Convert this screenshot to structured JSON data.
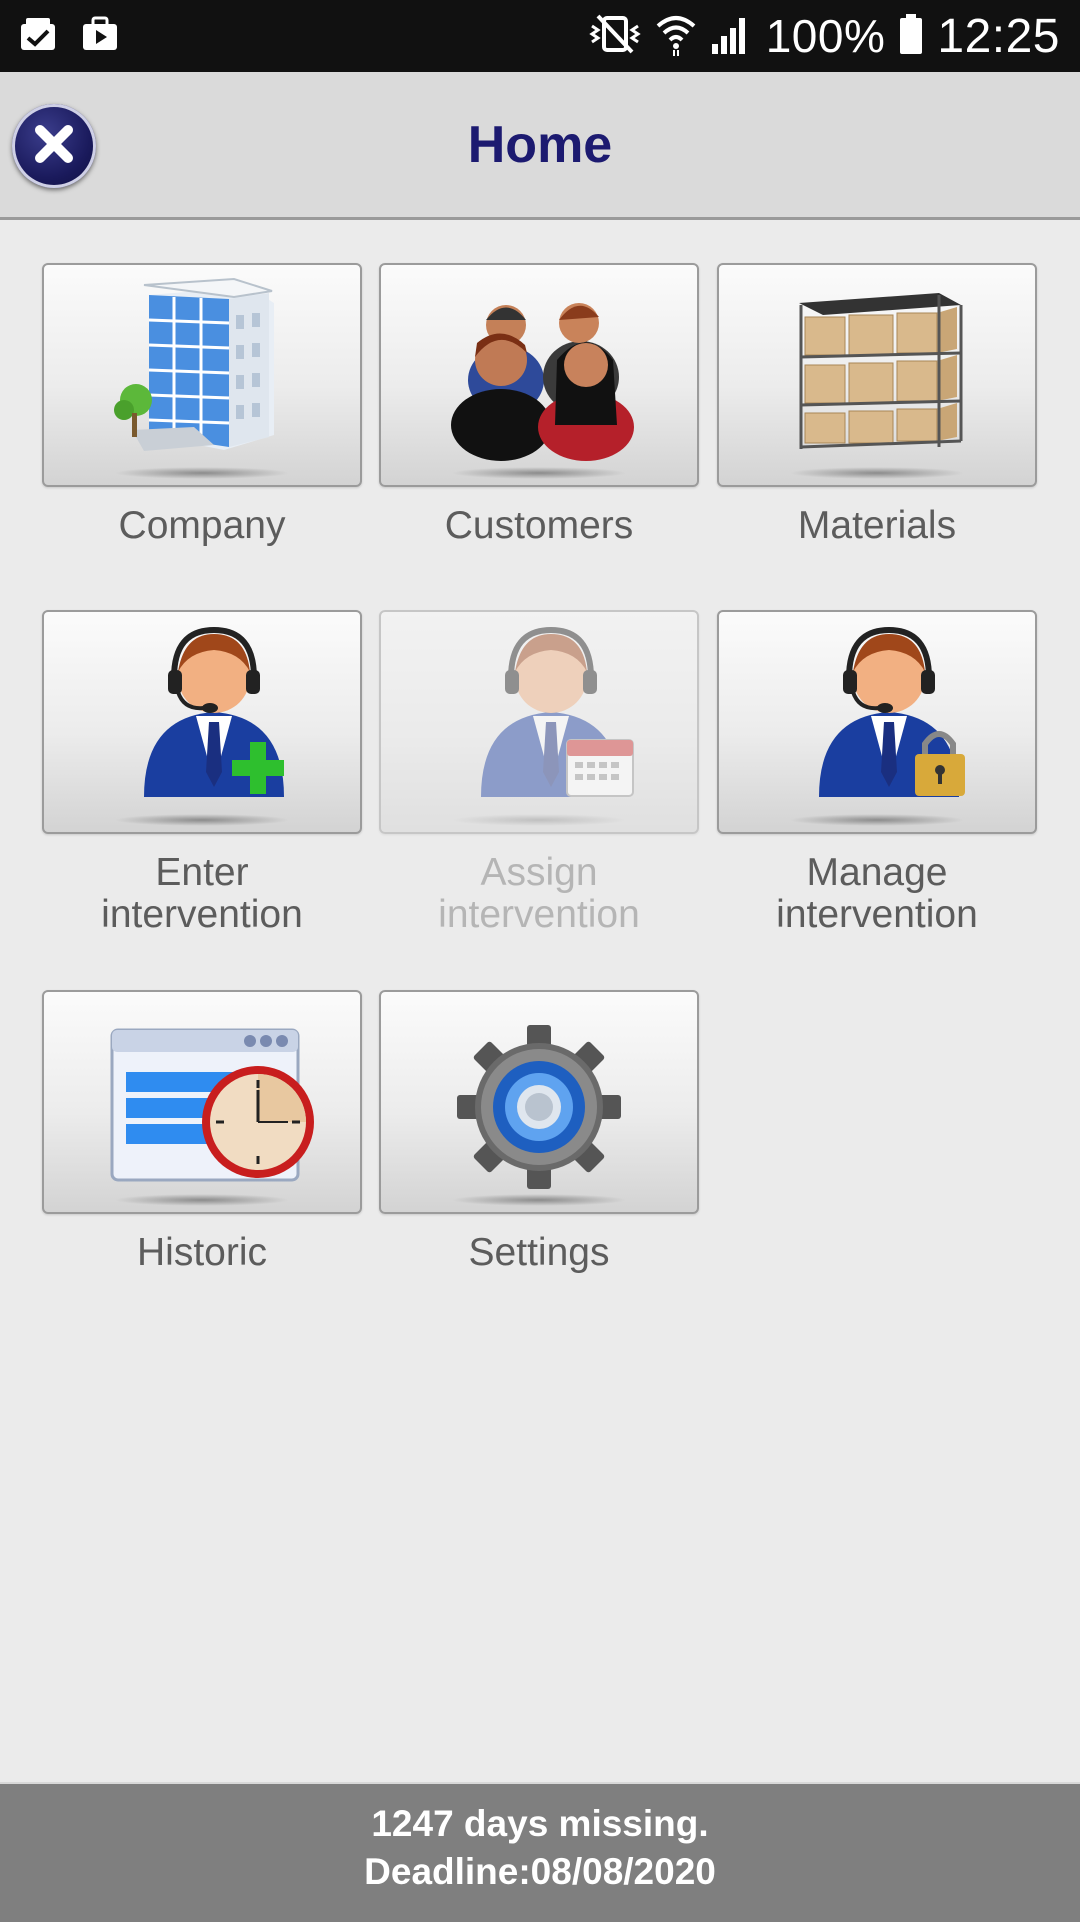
{
  "status_bar": {
    "battery": "100%",
    "time": "12:25",
    "icons": [
      "clipboard-check-icon",
      "video-bag-icon",
      "vibrate-mute-icon",
      "wifi-icon",
      "signal-icon",
      "battery-icon"
    ]
  },
  "header": {
    "title": "Home",
    "close_icon": "close-icon"
  },
  "tiles": [
    {
      "label": "Company",
      "icon": "office-building-icon",
      "enabled": true
    },
    {
      "label": "Customers",
      "icon": "people-group-icon",
      "enabled": true
    },
    {
      "label": "Materials",
      "icon": "warehouse-shelf-icon",
      "enabled": true
    },
    {
      "label_line1": "Enter",
      "label_line2": "intervention",
      "icon": "agent-add-icon",
      "enabled": true
    },
    {
      "label_line1": "Assign",
      "label_line2": "intervention",
      "icon": "agent-calendar-icon",
      "enabled": false
    },
    {
      "label_line1": "Manage",
      "label_line2": "intervention",
      "icon": "agent-lock-icon",
      "enabled": true
    },
    {
      "label": "Historic",
      "icon": "window-clock-icon",
      "enabled": true
    },
    {
      "label": "Settings",
      "icon": "gear-icon",
      "enabled": true
    }
  ],
  "footer": {
    "line1": "1247 days missing.",
    "line2": "Deadline:08/08/2020"
  },
  "colors": {
    "title": "#1c1a70",
    "header_bg": "#dadada",
    "page_bg": "#ebebeb",
    "footer_bg": "#7f7f7f",
    "status_bg": "#111111"
  }
}
